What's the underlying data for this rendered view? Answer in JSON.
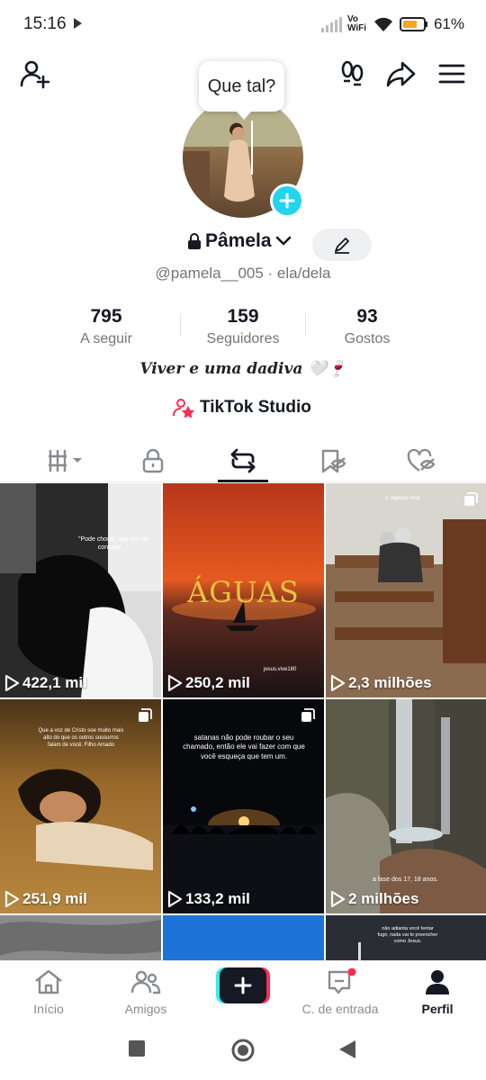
{
  "status_bar": {
    "time": "15:16",
    "network": "Vo WiFi",
    "battery": "61%"
  },
  "tooltip": {
    "text": "Que tal?"
  },
  "profile": {
    "name": "Pâmela",
    "handle": "@pamela__005 · ela/dela",
    "stats": [
      {
        "value": "795",
        "label": "A seguir"
      },
      {
        "value": "159",
        "label": "Seguidores"
      },
      {
        "value": "93",
        "label": "Gostos"
      }
    ],
    "bio": "Viver e uma dadiva 🤍🍷",
    "studio_label": "TikTok Studio"
  },
  "grid": [
    {
      "views": "422,1 mil",
      "caption": "\"Pode chorar, que ele vai consolar...\""
    },
    {
      "views": "250,2 mil",
      "caption": "ÁGUAS",
      "credit": "jesus.vive180"
    },
    {
      "views": "2,3 milhões",
      "caption": "o objetivo final."
    },
    {
      "views": "251,9 mil",
      "caption": "Que a voz de Cristo soe muito mais alto do que os outros sussurros falam de você. Filho Amado"
    },
    {
      "views": "133,2 mil",
      "caption": "satanas não pode roubar o seu chamado, então ele vai fazer com que você esqueça que tem um."
    },
    {
      "views": "2 milhões",
      "caption": "a fase dos 17, 18 anos."
    },
    {
      "caption": ""
    },
    {
      "caption": ""
    },
    {
      "caption": "não adianta você tentar fugir, nada vai te preencher como Jesus."
    }
  ],
  "bottom_nav": [
    {
      "label": "Início",
      "icon": "home-icon"
    },
    {
      "label": "Amigos",
      "icon": "friends-icon"
    },
    {
      "label": "",
      "icon": "plus-icon"
    },
    {
      "label": "C. de entrada",
      "icon": "inbox-icon"
    },
    {
      "label": "Perfil",
      "icon": "profile-icon"
    }
  ],
  "colors": {
    "accent": "#20d5ec",
    "brand_red": "#fe2c55",
    "text_primary": "#161823",
    "text_secondary": "#73747a"
  }
}
